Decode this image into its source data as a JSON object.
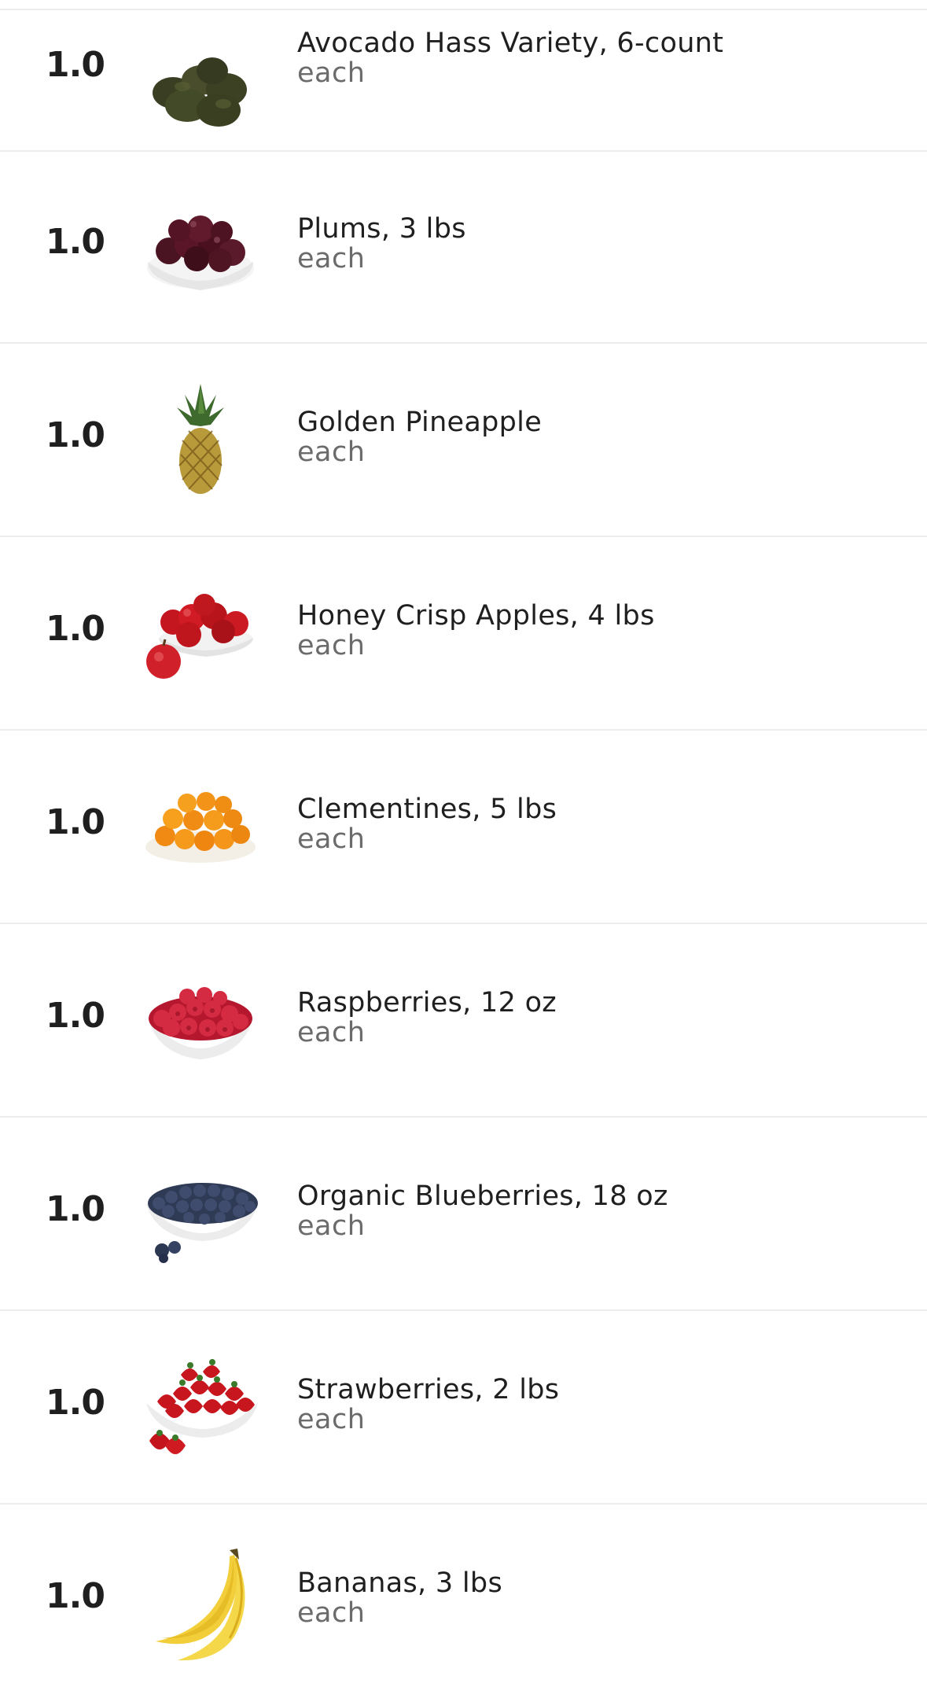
{
  "items": [
    {
      "quantity": "1.0",
      "name": "Avocado Hass Variety, 6-count",
      "unit": "each",
      "image": "avocado-icon"
    },
    {
      "quantity": "1.0",
      "name": "Plums, 3 lbs",
      "unit": "each",
      "image": "plums-icon"
    },
    {
      "quantity": "1.0",
      "name": "Golden Pineapple",
      "unit": "each",
      "image": "pineapple-icon"
    },
    {
      "quantity": "1.0",
      "name": "Honey Crisp Apples, 4 lbs",
      "unit": "each",
      "image": "apples-icon"
    },
    {
      "quantity": "1.0",
      "name": "Clementines, 5 lbs",
      "unit": "each",
      "image": "clementines-icon"
    },
    {
      "quantity": "1.0",
      "name": "Raspberries, 12 oz",
      "unit": "each",
      "image": "raspberries-icon"
    },
    {
      "quantity": "1.0",
      "name": "Organic Blueberries, 18 oz",
      "unit": "each",
      "image": "blueberries-icon"
    },
    {
      "quantity": "1.0",
      "name": "Strawberries, 2 lbs",
      "unit": "each",
      "image": "strawberries-icon"
    },
    {
      "quantity": "1.0",
      "name": "Bananas, 3 lbs",
      "unit": "each",
      "image": "bananas-icon"
    }
  ]
}
